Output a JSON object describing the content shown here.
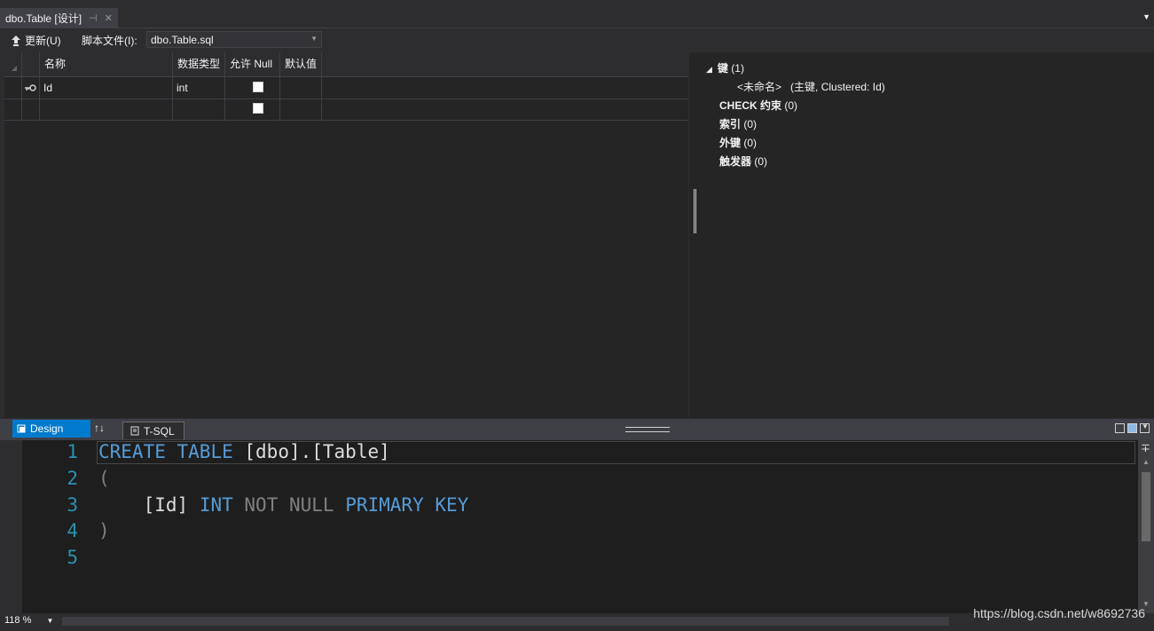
{
  "tab": {
    "title": "dbo.Table [设计]",
    "pin_glyph": "⊣",
    "close_glyph": "✕"
  },
  "toolbar": {
    "update_label": "更新(U)",
    "script_label": "脚本文件(I):",
    "script_value": "dbo.Table.sql"
  },
  "grid": {
    "columns": [
      "名称",
      "数据类型",
      "允许 Null",
      "默认值"
    ],
    "rows": [
      {
        "name": "Id",
        "type": "int",
        "allow_null": false,
        "key": true
      },
      {
        "name": "",
        "type": "",
        "allow_null": false,
        "key": false
      }
    ]
  },
  "tree": {
    "keys_label": "键",
    "keys_count": "(1)",
    "key_item_name": "<未命名>",
    "key_item_detail": "(主键, Clustered: Id)",
    "check_label": "CHECK 约束",
    "check_count": "(0)",
    "index_label": "索引",
    "index_count": "(0)",
    "fk_label": "外键",
    "fk_count": "(0)",
    "trigger_label": "触发器",
    "trigger_count": "(0)"
  },
  "panes": {
    "design_label": "Design",
    "swap_glyph": "↑↓",
    "tsql_label": "T-SQL"
  },
  "editor": {
    "line_numbers": [
      "1",
      "2",
      "3",
      "4",
      "5"
    ],
    "line1": {
      "kw1": "CREATE",
      "kw2": "TABLE",
      "ident": "[dbo].[Table]"
    },
    "line2": "(",
    "line3": {
      "ident": "[Id]",
      "kw1": "INT",
      "not_null": "NOT NULL",
      "kw2": "PRIMARY KEY"
    },
    "line4": ")"
  },
  "status": {
    "zoom": "118 %",
    "watermark": "https://blog.csdn.net/w8692736"
  },
  "colors": {
    "accent": "#007acc",
    "keyword": "#569cd6",
    "line_number": "#2b91af"
  }
}
